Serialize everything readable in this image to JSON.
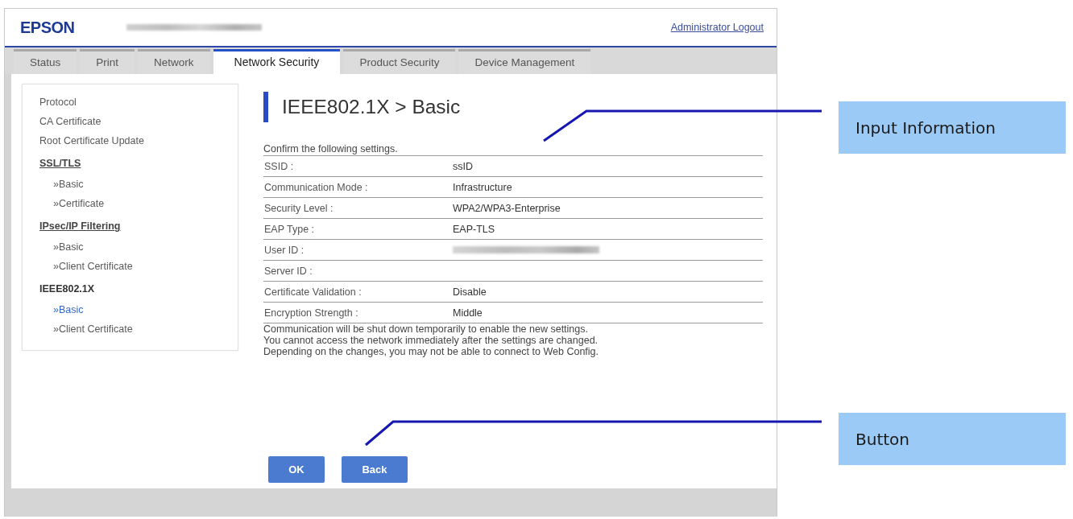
{
  "header": {
    "logo": "EPSON",
    "logout_link": "Administrator Logout"
  },
  "tabs": [
    {
      "label": "Status",
      "selected": false
    },
    {
      "label": "Print",
      "selected": false
    },
    {
      "label": "Network",
      "selected": false
    },
    {
      "label": "Network Security",
      "selected": true
    },
    {
      "label": "Product Security",
      "selected": false
    },
    {
      "label": "Device Management",
      "selected": false
    }
  ],
  "sidebar": {
    "items": [
      {
        "kind": "link",
        "label": "Protocol",
        "selected": false
      },
      {
        "kind": "link",
        "label": "CA Certificate",
        "selected": false
      },
      {
        "kind": "link",
        "label": "Root Certificate Update",
        "selected": false
      },
      {
        "kind": "section",
        "label": "SSL/TLS",
        "selected": false,
        "children": [
          {
            "label": "»Basic",
            "selected": false
          },
          {
            "label": "»Certificate",
            "selected": false
          }
        ]
      },
      {
        "kind": "section",
        "label": "IPsec/IP Filtering",
        "selected": false,
        "children": [
          {
            "label": "»Basic",
            "selected": false
          },
          {
            "label": "»Client Certificate",
            "selected": false
          }
        ]
      },
      {
        "kind": "section",
        "label": "IEEE802.1X",
        "selected": true,
        "children": [
          {
            "label": "»Basic",
            "selected": true
          },
          {
            "label": "»Client Certificate",
            "selected": false
          }
        ]
      }
    ]
  },
  "main": {
    "title": "IEEE802.1X > Basic",
    "intro": "Confirm the following settings.",
    "settings": [
      {
        "kind": "text",
        "label": "SSID :",
        "value": "ssID"
      },
      {
        "kind": "text",
        "label": "Communication Mode :",
        "value": "Infrastructure"
      },
      {
        "kind": "text",
        "label": "Security Level :",
        "value": "WPA2/WPA3-Enterprise"
      },
      {
        "kind": "text",
        "label": "EAP Type :",
        "value": "EAP-TLS"
      },
      {
        "kind": "redacted",
        "label": "User ID :"
      },
      {
        "kind": "text",
        "label": "Server ID :"
      },
      {
        "kind": "text",
        "label": "Certificate Validation :",
        "value": "Disable"
      },
      {
        "kind": "text",
        "label": "Encryption Strength :",
        "value": "Middle"
      }
    ],
    "notes": [
      "Communication will be shut down temporarily to enable the new settings.",
      "You cannot access the network immediately after the settings are changed.",
      "Depending on the changes, you may not be able to connect to Web Config."
    ],
    "buttons": [
      "OK",
      "Back"
    ]
  },
  "callouts": [
    {
      "label": "Input Information"
    },
    {
      "label": "Button"
    }
  ]
}
